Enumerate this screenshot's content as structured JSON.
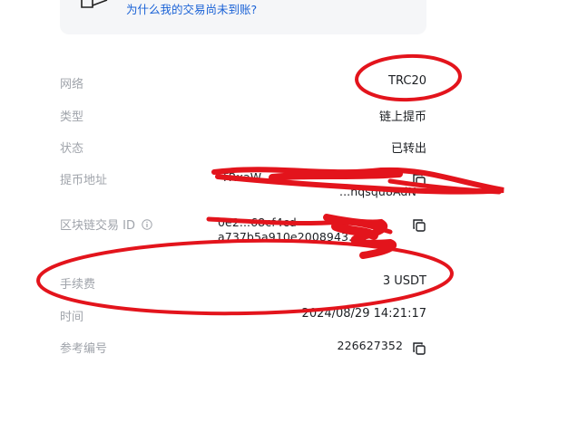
{
  "help": {
    "link_text": "为什么我的交易尚未到账?"
  },
  "details": {
    "network": {
      "label": "网络",
      "value": "TRC20"
    },
    "type": {
      "label": "类型",
      "value": "链上提币"
    },
    "status": {
      "label": "状态",
      "value": "已转出"
    },
    "address": {
      "label": "提币地址",
      "line1": "TRxaW...",
      "line2": "...hqsqu8AdN"
    },
    "txid": {
      "label": "区块链交易 ID",
      "line1": "0e2...68cf4cd",
      "line2": "a737b5a910e2008943...b"
    },
    "fee": {
      "label": "手续费",
      "value": "3 USDT"
    },
    "time": {
      "label": "时间",
      "value": "2024/08/29 14:21:17"
    },
    "reference": {
      "label": "参考编号",
      "value": "226627352"
    }
  },
  "icons": {
    "help": "document-icon",
    "info": "info-icon",
    "copy": "copy-icon"
  },
  "colors": {
    "link": "#1a62d6",
    "label": "#a0a4ab",
    "value": "#1c1f23",
    "annotation": "#e3141c"
  }
}
